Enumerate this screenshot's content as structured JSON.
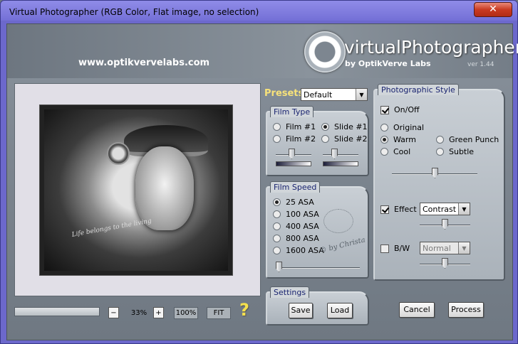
{
  "window": {
    "title": "Virtual Photographer (RGB Color, Flat image, no selection)",
    "close_label": "✕"
  },
  "header": {
    "url": "www.optikvervelabs.com",
    "logo_title": "virtualPhotographer",
    "logo_sub": "by OptikVerve Labs",
    "version": "ver 1.44"
  },
  "preview": {
    "caption": "Life belongs to the living",
    "watermark": "© by Christa"
  },
  "presets": {
    "label": "Presets",
    "value": "Default"
  },
  "film_type": {
    "legend": "Film Type",
    "options": [
      "Film #1",
      "Film #2",
      "Slide #1",
      "Slide #2"
    ],
    "selected": "Slide #1"
  },
  "film_speed": {
    "legend": "Film Speed",
    "options": [
      "25 ASA",
      "100 ASA",
      "400 ASA",
      "800 ASA",
      "1600 ASA"
    ],
    "selected": "25 ASA"
  },
  "settings": {
    "legend": "Settings",
    "save": "Save",
    "load": "Load"
  },
  "style": {
    "legend": "Photographic Style",
    "onoff": "On/Off",
    "onoff_checked": true,
    "options": [
      "Original",
      "Warm",
      "Cool",
      "Green Punch",
      "Subtle"
    ],
    "selected": "Warm",
    "effect_label": "Effect",
    "effect_checked": true,
    "effect_value": "Contrast",
    "bw_label": "B/W",
    "bw_checked": false,
    "bw_value": "Normal"
  },
  "actions": {
    "cancel": "Cancel",
    "process": "Process"
  },
  "zoom": {
    "minus": "−",
    "value": "33%",
    "plus": "+",
    "zoom100": "100%",
    "fit": "FIT",
    "help": "?"
  },
  "levels": {
    "film_slider_1": 0.45,
    "film_slider_2": 0.3,
    "speed_slider": 0.0,
    "style_slider": 0.5,
    "effect_slider": 0.5,
    "bw_slider": 0.5
  },
  "colors": {
    "accent_gold": "#f7e27a",
    "legend_text": "#1a2470",
    "title_bar": "#7470d6"
  }
}
